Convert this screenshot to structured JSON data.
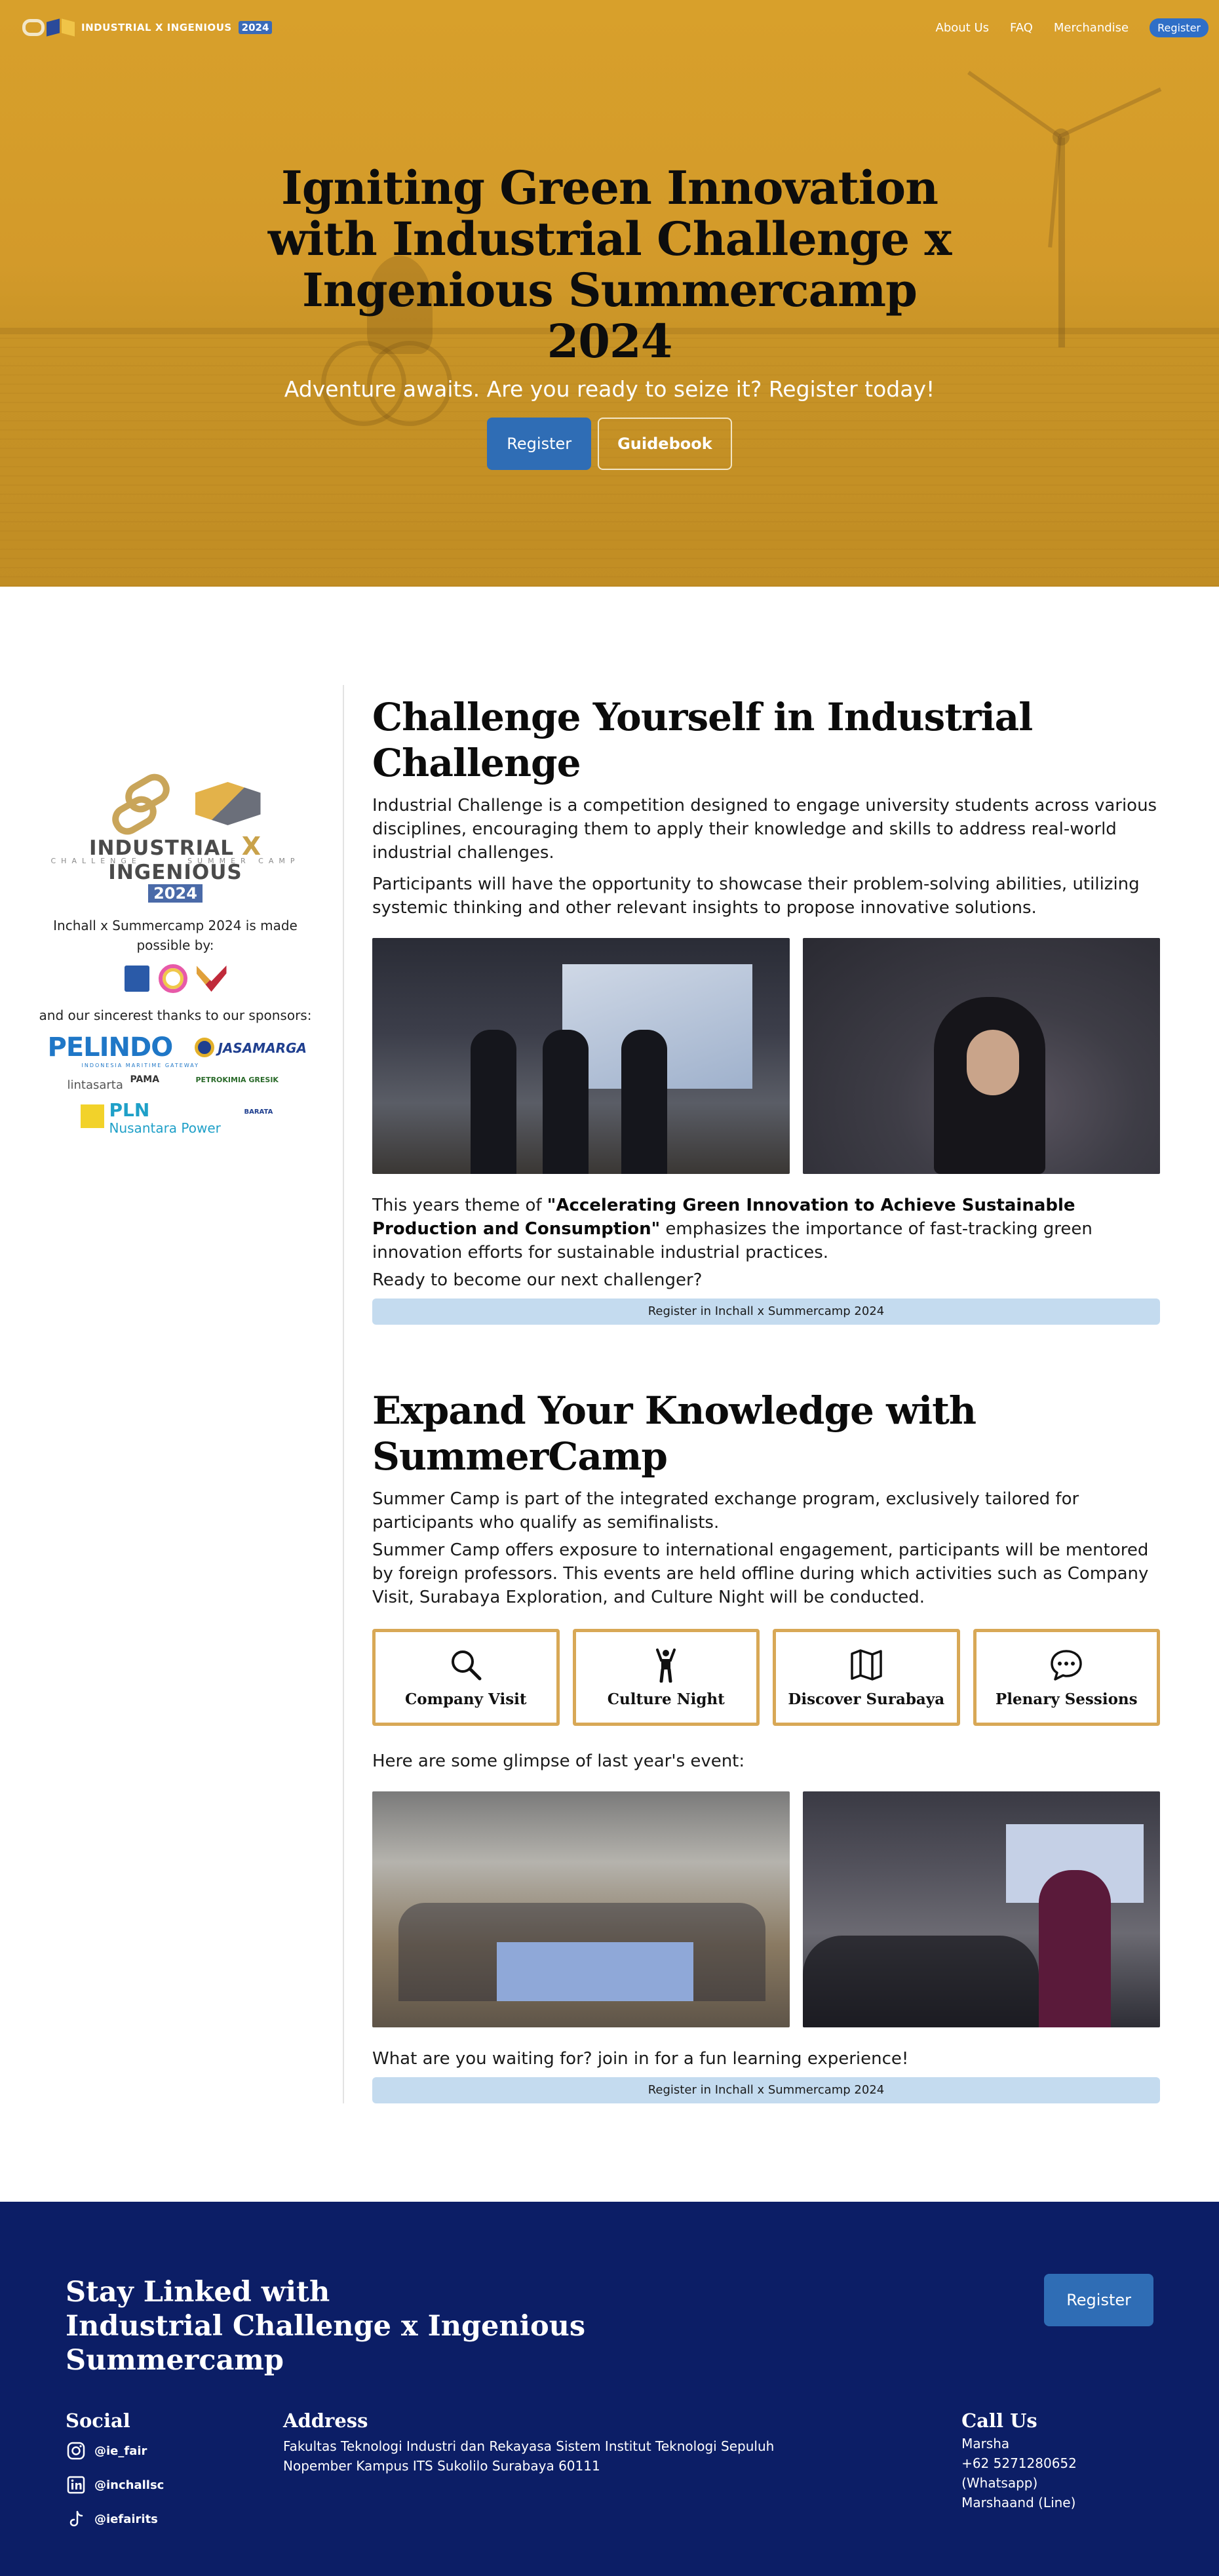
{
  "nav": {
    "brand": "INDUSTRIAL X INGENIOUS",
    "year": "2024",
    "links": [
      "About Us",
      "FAQ",
      "Merchandise"
    ],
    "register": "Register"
  },
  "hero": {
    "title": "Igniting Green Innovation with Industrial Challenge x Ingenious Summercamp 2024",
    "subtitle": "Adventure awaits. Are you ready to seize it? Register today!",
    "primary_button": "Register",
    "secondary_button": "Guidebook",
    "colors": {
      "overlay": "#d8a02b"
    }
  },
  "sidebar": {
    "logo": {
      "line1": "INDUSTRIAL",
      "x": "X",
      "line1b": "INGENIOUS",
      "sub_left": "CHALLENGE",
      "sub_right": "SUMMER CAMP",
      "year": "2024"
    },
    "made_possible": "Inchall x Summercamp 2024 is made possible by:",
    "sponsors_title": "and our sincerest thanks to our sponsors:",
    "sponsors": {
      "pelindo": "PELINDO",
      "pelindo_sub": "INDONESIA MARITIME GATEWAY",
      "jasamarga": "JASAMARGA",
      "lintasarta": "lintasarta",
      "pama": "PAMA",
      "petrokimia": "PETROKIMIA GRESIK",
      "pln": "PLN",
      "nusantara": "Nusantara Power",
      "barata": "BARATA"
    }
  },
  "challenge": {
    "heading": "Challenge Yourself in Industrial Challenge",
    "para1": "Industrial Challenge is a competition designed to engage university students across various disciplines, encouraging them to apply their knowledge and skills to address real-world industrial challenges.",
    "para2": "Participants will have the opportunity to showcase their problem-solving abilities, utilizing systemic thinking and other relevant insights to propose innovative solutions.",
    "theme_prefix": "This years theme of ",
    "theme_bold": "\"Accelerating Green Innovation to Achieve Sustainable Production and Consumption\"",
    "theme_suffix": " emphasizes the importance of fast-tracking green innovation efforts for sustainable industrial practices.",
    "ready": "Ready to become our next challenger?",
    "cta": "Register in Inchall x Summercamp 2024"
  },
  "summercamp": {
    "heading": "Expand Your Knowledge with SummerCamp",
    "para1": "Summer Camp is part of the integrated exchange program, exclusively tailored for participants who qualify as semifinalists.",
    "para2": "Summer Camp offers exposure to international engagement, participants will be mentored by foreign professors. This events are held offline during which activities such as Company Visit, Surabaya Exploration, and Culture Night will be conducted.",
    "cards": [
      {
        "label": "Company Visit",
        "icon": "search-icon"
      },
      {
        "label": "Culture Night",
        "icon": "person-celebrating-icon"
      },
      {
        "label": "Discover Surabaya",
        "icon": "map-icon"
      },
      {
        "label": "Plenary Sessions",
        "icon": "chat-bubble-icon"
      }
    ],
    "glimpse": "Here are some glimpse of last year's event:",
    "waiting": "What are you waiting for? join in for a fun learning experience!",
    "cta": "Register in Inchall x Summercamp 2024"
  },
  "footer": {
    "title_line1": "Stay Linked with",
    "title_line2": "Industrial Challenge x Ingenious Summercamp",
    "register": "Register",
    "social_heading": "Social",
    "social": [
      {
        "icon": "instagram-icon",
        "handle": "@ie_fair"
      },
      {
        "icon": "linkedin-icon",
        "handle": "@inchallsc"
      },
      {
        "icon": "tiktok-icon",
        "handle": "@iefairits"
      }
    ],
    "address_heading": "Address",
    "address": "Fakultas Teknologi Industri dan Rekayasa Sistem Institut Teknologi Sepuluh Nopember Kampus ITS Sukolilo Surabaya 60111",
    "call_heading": "Call Us",
    "call": [
      "Marsha",
      "+62 5271280652 (Whatsapp)",
      "Marshaand (Line)"
    ],
    "colors": {
      "background": "#0c1e66",
      "button": "#2f6db5"
    }
  }
}
